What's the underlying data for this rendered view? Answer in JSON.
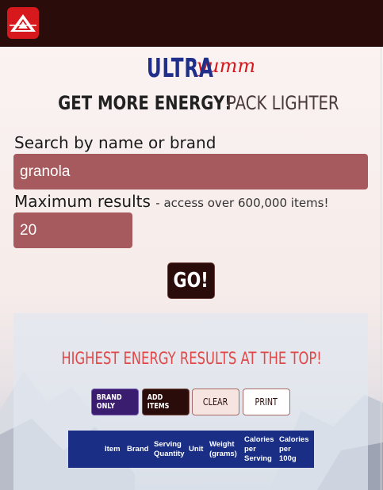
{
  "brand": {
    "ultra": "ULTRA",
    "yumm": "yumm"
  },
  "tagline": {
    "part1": "GET MORE ENERGY!",
    "part2": "PACK LIGHTER"
  },
  "search": {
    "label": "Search by name or brand",
    "value": "granola"
  },
  "max_results": {
    "label": "Maximum results",
    "hint": "- access over 600,000 items!",
    "value": "20"
  },
  "go_label": "GO!",
  "results": {
    "title": "HIGHEST ENERGY RESULTS AT THE TOP!",
    "buttons": {
      "brand_only": "BRAND ONLY",
      "add_items": "ADD ITEMS",
      "clear": "CLEAR",
      "print": "PRINT"
    },
    "columns": [
      "Item",
      "Brand",
      "Serving Quantity",
      "Unit",
      "Weight (grams)",
      "Calories per Serving",
      "Calories per 100g"
    ]
  },
  "colors": {
    "topbar": "#2a0c0a",
    "logo": "#d7181d",
    "input_bg": "#a75a5e",
    "table_head": "#1a2e85",
    "results_title": "#e04848"
  },
  "icons": {
    "logo": "mountain-logo-icon"
  }
}
